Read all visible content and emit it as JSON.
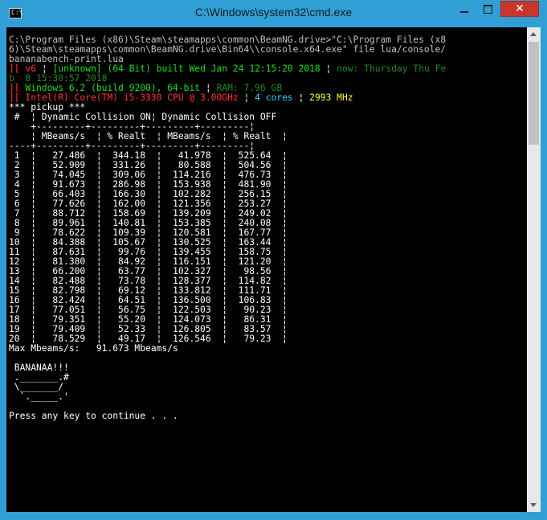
{
  "window": {
    "title": "C:\\Windows\\system32\\cmd.exe",
    "icon_label": "C:\\",
    "close_label": "✕"
  },
  "console": {
    "cmd_line_1": "C:\\Program Files (x86)\\Steam\\steamapps\\common\\BeamNG.drive>\"C:\\Program Files (x8",
    "cmd_line_2": "6)\\Steam\\steamapps\\common\\BeamNG.drive\\Bin64\\\\console.x64.exe\" file lua/console/",
    "cmd_line_3": "bananabench-print.lua",
    "info1_prefix": "][",
    "info1_version": "v6",
    "info1_build": "[unknown] (64 Bit) built Wed Jan 24 12:15:20 2018",
    "info1_now": "now: Thursday Thu Fe",
    "info1_now_cont": "b  8 15:30:57 2018",
    "info2_prefix": "][",
    "info2_os": "Windows 6.2 (build 9200), 64-bit",
    "info2_ram": "RAM: 7.96 GB",
    "info3_prefix": "][",
    "info3_cpu": "Intel(R) Core(TM) i5-3330 CPU @ 3.00GHz",
    "info3_cores": "4 cores",
    "info3_mhz": "2993 MHz",
    "section": "*** pickup ***",
    "header1": " #  ¦ Dynamic Collision ON¦ Dynamic Collision OFF",
    "sep1": "    +---------+---------+---------+---------¦",
    "header2": "    ¦ MBeams/s  ¦ % Realt  ¦ MBeams/s  ¦ % Realt  ¦",
    "sep2": "----+---------+---------+---------+---------¦",
    "rows": [
      " 1  ¦   27.486  ¦  344.18  ¦   41.978  ¦  525.64  ¦",
      " 2  ¦   52.909  ¦  331.26  ¦   80.588  ¦  504.56  ¦",
      " 3  ¦   74.045  ¦  309.06  ¦  114.216  ¦  476.73  ¦",
      " 4  ¦   91.673  ¦  286.98  ¦  153.938  ¦  481.90  ¦",
      " 5  ¦   66.403  ¦  166.30  ¦  102.282  ¦  256.15  ¦",
      " 6  ¦   77.626  ¦  162.00  ¦  121.356  ¦  253.27  ¦",
      " 7  ¦   88.712  ¦  158.69  ¦  139.209  ¦  249.02  ¦",
      " 8  ¦   89.961  ¦  140.81  ¦  153.385  ¦  240.08  ¦",
      " 9  ¦   78.622  ¦  109.39  ¦  120.581  ¦  167.77  ¦",
      "10  ¦   84.388  ¦  105.67  ¦  130.525  ¦  163.44  ¦",
      "11  ¦   87.631  ¦   99.76  ¦  139.455  ¦  158.75  ¦",
      "12  ¦   81.380  ¦   84.92  ¦  116.151  ¦  121.20  ¦",
      "13  ¦   66.200  ¦   63.77  ¦  102.327  ¦   98.56  ¦",
      "14  ¦   82.488  ¦   73.78  ¦  128.377  ¦  114.82  ¦",
      "15  ¦   82.798  ¦   69.12  ¦  133.812  ¦  111.71  ¦",
      "16  ¦   82.424  ¦   64.51  ¦  136.500  ¦  106.83  ¦",
      "17  ¦   77.051  ¦   56.75  ¦  122.503  ¦   90.23  ¦",
      "18  ¦   79.351  ¦   55.20  ¦  124.073  ¦   86.31  ¦",
      "19  ¦   79.409  ¦   52.33  ¦  126.805  ¦   83.57  ¦",
      "20  ¦   78.529  ¦   49.17  ¦  126.546  ¦   79.23  ¦"
    ],
    "max_line": "Max Mbeams/s:   91.673 Mbeams/s",
    "banana_1": " BANANAA!!!",
    "banana_2": " ._______.#",
    "banana_3": " \\_______/",
    "banana_4": "  `._____.'",
    "prompt": "Press any key to continue . . ."
  },
  "colors": {
    "titlebar": "#2f9fd6",
    "console_bg": "#000000",
    "close_button": "#c7362a"
  }
}
